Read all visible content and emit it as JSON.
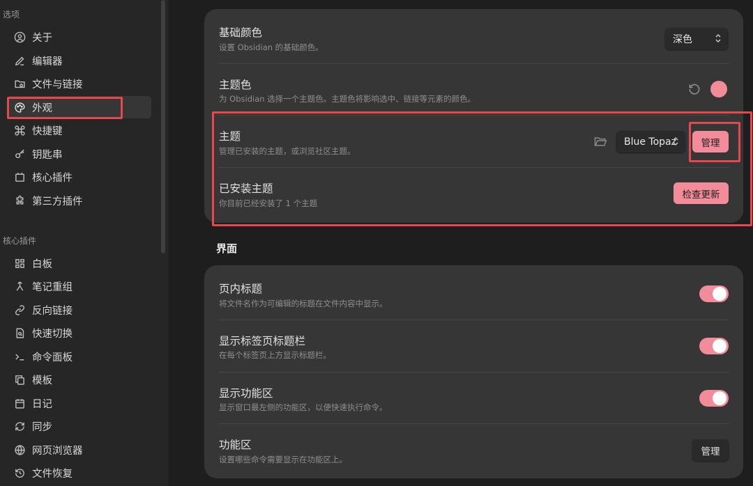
{
  "sidebar": {
    "group_options": "选项",
    "options_items": [
      {
        "label": "关于",
        "icon": "user-circle-icon"
      },
      {
        "label": "编辑器",
        "icon": "pencil-icon"
      },
      {
        "label": "文件与链接",
        "icon": "folder-link-icon"
      },
      {
        "label": "外观",
        "icon": "palette-icon",
        "active": true
      },
      {
        "label": "快捷键",
        "icon": "command-icon"
      },
      {
        "label": "钥匙串",
        "icon": "key-icon"
      },
      {
        "label": "核心插件",
        "icon": "calendar-box-icon"
      },
      {
        "label": "第三方插件",
        "icon": "puzzle-icon"
      }
    ],
    "group_core_plugins": "核心插件",
    "core_items": [
      {
        "label": "白板",
        "icon": "layout-grid-icon"
      },
      {
        "label": "笔记重组",
        "icon": "merge-icon"
      },
      {
        "label": "反向链接",
        "icon": "backlink-icon"
      },
      {
        "label": "快速切换",
        "icon": "file-search-icon"
      },
      {
        "label": "命令面板",
        "icon": "terminal-icon"
      },
      {
        "label": "模板",
        "icon": "copy-icon"
      },
      {
        "label": "日记",
        "icon": "calendar-icon"
      },
      {
        "label": "同步",
        "icon": "sync-icon"
      },
      {
        "label": "网页浏览器",
        "icon": "globe-icon"
      },
      {
        "label": "文件恢复",
        "icon": "history-icon"
      }
    ]
  },
  "appearance": {
    "base_color": {
      "title": "基础颜色",
      "desc": "设置 Obsidian 的基础颜色。",
      "value": "深色"
    },
    "accent_color": {
      "title": "主题色",
      "desc": "为 Obsidian 选择一个主题色。主题色将影响选中、链接等元素的颜色。",
      "color": "#f28c9b"
    },
    "theme": {
      "title": "主题",
      "desc": "管理已安装的主题，或浏览社区主题。",
      "value": "Blue Topaz",
      "manage_label": "管理"
    },
    "installed_themes": {
      "title": "已安装主题",
      "desc": "你目前已经安装了 1 个主题",
      "button_label": "检查更新"
    }
  },
  "interface": {
    "heading": "界面",
    "inline_title": {
      "title": "页内标题",
      "desc": "将文件名作为可编辑的标题在文件内容中显示。",
      "enabled": true
    },
    "tab_title_bar": {
      "title": "显示标签页标题栏",
      "desc": "在每个标签页上方显示标题栏。",
      "enabled": true
    },
    "ribbon": {
      "title": "显示功能区",
      "desc": "显示窗口最左侧的功能区，以便快速执行命令。",
      "enabled": true
    },
    "ribbon_config": {
      "title": "功能区",
      "desc": "设置哪些命令需要显示在功能区上。",
      "button_label": "管理"
    }
  },
  "colors": {
    "accent": "#f28c9b",
    "highlight": "#e5484d"
  }
}
